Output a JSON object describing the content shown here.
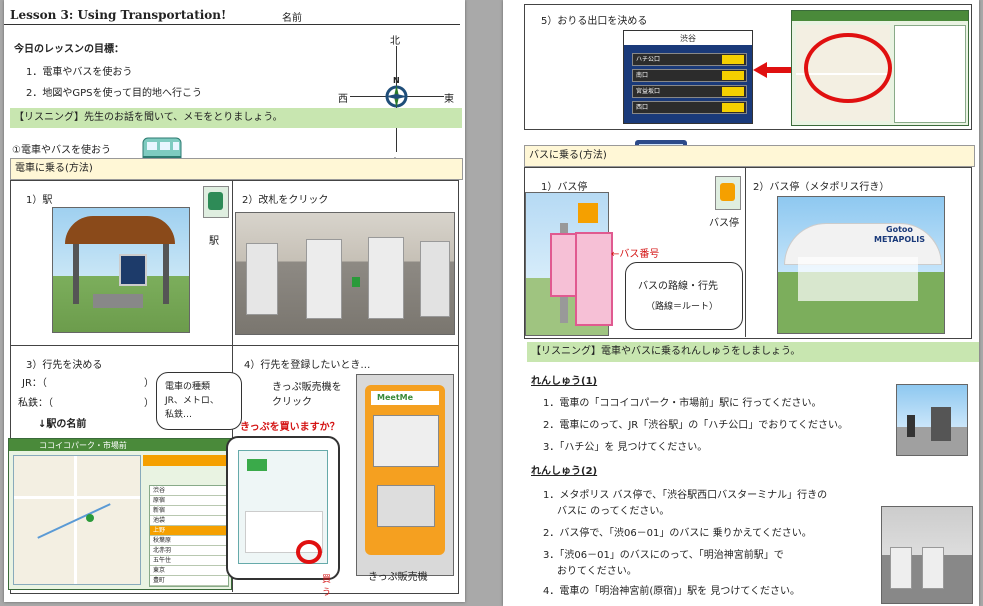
{
  "left": {
    "lesson_title": "Lesson 3: Using Transportation!",
    "name_label": "名前",
    "goals_title": "今日のレッスンの目標：",
    "goals": [
      "1．電車やバスを使おう",
      "2．地図やGPSを使って目的地へ行こう"
    ],
    "compass": {
      "north": "北",
      "south": "南",
      "east": "東",
      "west": "西",
      "n_mark": "N"
    },
    "listening_bar": "【リスニング】先生のお話を聞いて、メモをとりましょう。",
    "section1": "①電車やバスを使おう",
    "train_how_bar": "電車に乗る(方法)",
    "step1": "1）駅",
    "step1_side_label": "駅",
    "step2": "2）改札をクリック",
    "step3": "3）行先を決める",
    "jr_label": "JR：（",
    "jr_close": "）",
    "private_label": "私鉄：（",
    "private_close": "）",
    "station_name": "↓駅の名前",
    "bubble_train_types": [
      "電車の種類",
      "JR、メトロ、",
      "私鉄…"
    ],
    "step4": "4）行先を登録したいとき…",
    "step4_desc": [
      "きっぷ販売機を",
      "クリック"
    ],
    "buy_ticket_q": "きっぷを買いますか？",
    "buy_label": "買う",
    "ticket_machine_label": "きっぷ販売機",
    "map_station_title": "ココイコパーク・市場前",
    "map_stations": [
      "渋谷",
      "原宿",
      "新宿",
      "池袋",
      "上野",
      "秋葉原",
      "北赤羽",
      "五午住",
      "東京",
      "豊町"
    ],
    "meetme_logo": "MeetMe"
  },
  "right": {
    "step5": "5）おりる出口を決める",
    "shibuya_title": "渋谷",
    "exit_label": "出口",
    "exit_rows": [
      "ハチ公口",
      "南口",
      "宮益坂口",
      "西口"
    ],
    "bus_how_bar": "バスに乗る(方法)",
    "bus_step1": "1）バス停",
    "bus_step1_side": "バス停",
    "bus_step2": "2）バス停（メタポリス行き）",
    "bus_number_label": "←バス番号",
    "route_bubble": [
      "バスの路線・行先",
      "（路線＝ルート）"
    ],
    "metapolis_logo": [
      "Gotoo",
      "METAPOLIS"
    ],
    "listening_bar": "【リスニング】電車やバスに乗るれんしゅうをしましょう。",
    "practice1_title": "れんしゅう(1)",
    "practice1_items": [
      "1．電車の「ココイコパーク・市場前」駅に 行ってください。",
      "2．電車にのって、JR「渋谷駅」の「ハチ公口」でおりてください。",
      "3．「ハチ公」を 見つけてください。"
    ],
    "practice2_title": "れんしゅう(2)",
    "practice2_items": [
      [
        "1．メタポリス バス停で、「渋谷駅西口バスターミナル」行きの",
        "バスに のってください。"
      ],
      [
        "2．バス停で、「渋06－01」のバスに 乗りかえてください。"
      ],
      [
        "3．「渋06－01」のバスにのって、「明治神宮前駅」で",
        "おりてください。"
      ],
      [
        "4．電車の「明治神宮前(原宿)」駅を 見つけてください。"
      ]
    ]
  }
}
